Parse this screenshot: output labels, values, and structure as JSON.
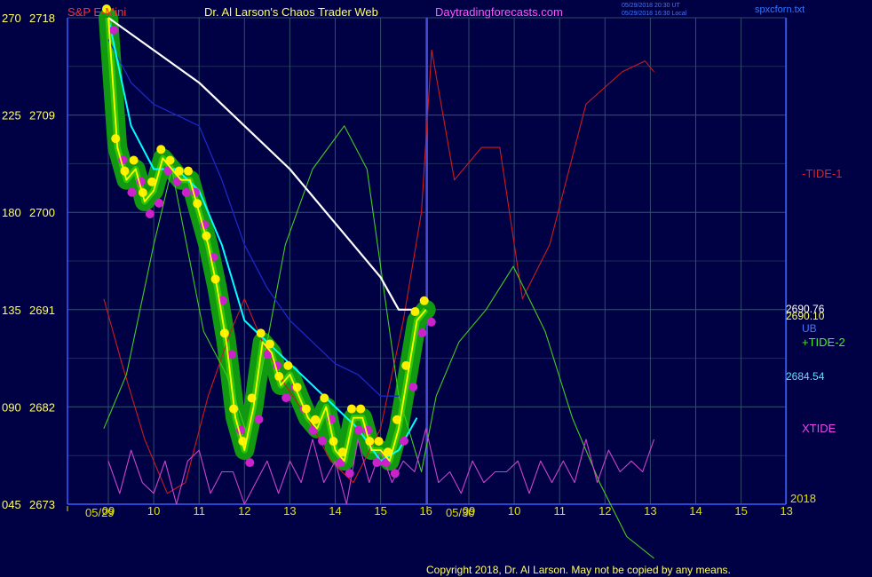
{
  "header": {
    "instrument": "S&P E-Mini",
    "title": "Dr. Al Larson's Chaos Trader Web",
    "site": "Daytradingforecasts.com",
    "stamp1": "05/29/2018 20:30 UT",
    "stamp2": "05/29/2018 16:30 Local",
    "filename": "spxcforn.txt"
  },
  "copyright": "Copyright 2018, Dr. Al Larson. May not be copied by any means.",
  "colors": {
    "background": "#000044",
    "grid": "#2e4d6a",
    "axis": "#3a5cff",
    "now_line": "#5a5aff",
    "label_left": "#ffff66",
    "label_right": "#ffffff"
  },
  "chart_data": {
    "type": "line",
    "title": "S&P E-Mini",
    "xlabel": "",
    "ylabel": "",
    "left_scale_labels": [
      "270",
      "225",
      "180",
      "135",
      "090",
      "045"
    ],
    "price_axis_labels": [
      "2718",
      "2709",
      "2700",
      "2691",
      "2682",
      "2673"
    ],
    "ylim": [
      2673,
      2718
    ],
    "x_hour_labels": [
      "09",
      "10",
      "11",
      "12",
      "13",
      "14",
      "15",
      "16",
      "09",
      "10",
      "11",
      "12",
      "13",
      "14",
      "15",
      "13"
    ],
    "x_date_labels": [
      "05/29",
      "05/30"
    ],
    "year_label": "2018",
    "grid": true,
    "right_labels": {
      "tide1": "-TIDE-1",
      "price1": "2690.76",
      "price2": "2690.10",
      "ub": "UB",
      "tide2": "+TIDE-2",
      "price3": "2684.54",
      "xtide": "XTIDE"
    },
    "series": [
      {
        "key": "price",
        "color": "#ffff00",
        "x": [
          9.0,
          9.2,
          9.4,
          9.6,
          9.8,
          10.0,
          10.2,
          10.4,
          10.6,
          10.8,
          11.0,
          11.2,
          11.4,
          11.6,
          11.8,
          12.0,
          12.2,
          12.4,
          12.6,
          12.8,
          13.0,
          13.2,
          13.4,
          13.6,
          13.8,
          14.0,
          14.2,
          14.4,
          14.6,
          14.8,
          15.0,
          15.2,
          15.4,
          15.6,
          15.8,
          16.0
        ],
        "y": [
          2718,
          2706,
          2703,
          2704,
          2701,
          2702,
          2705,
          2704,
          2703,
          2703,
          2700,
          2697,
          2693,
          2688,
          2681,
          2678,
          2682,
          2688,
          2687,
          2684,
          2685,
          2683,
          2681,
          2680,
          2682,
          2678,
          2677,
          2681,
          2681,
          2678,
          2678,
          2677,
          2680,
          2685,
          2690,
          2691
        ]
      },
      {
        "key": "ma1",
        "color": "#ffffff",
        "x": [
          9.0,
          10.0,
          11.0,
          12.0,
          13.0,
          14.0,
          15.0,
          15.4,
          15.8
        ],
        "y": [
          2718,
          2715,
          2712,
          2708,
          2704,
          2699,
          2694,
          2691,
          2691
        ]
      },
      {
        "key": "ma2",
        "color": "#00ffff",
        "x": [
          9.0,
          9.5,
          10.0,
          10.5,
          11.0,
          11.5,
          12.0,
          12.5,
          13.0,
          13.5,
          14.0,
          14.5,
          15.0,
          15.4,
          15.8
        ],
        "y": [
          2718,
          2708,
          2704,
          2704,
          2702,
          2697,
          2690,
          2688,
          2686,
          2684,
          2682,
          2680,
          2677,
          2678,
          2681
        ]
      },
      {
        "key": "ma3",
        "color": "#1a28c8",
        "x": [
          9.0,
          9.5,
          10.0,
          10.5,
          11.0,
          11.5,
          12.0,
          12.5,
          13.0,
          13.5,
          14.0,
          14.5,
          15.0,
          15.4
        ],
        "y": [
          2716,
          2712,
          2710,
          2709,
          2708,
          2703,
          2697,
          2693,
          2690,
          2688,
          2686,
          2685,
          2683,
          2683
        ]
      },
      {
        "key": "tide1",
        "color": "#cc1c1c",
        "x": [
          8.9,
          9.3,
          9.8,
          10.3,
          10.7,
          11.2,
          11.7,
          12.0,
          12.4,
          12.9,
          13.4,
          13.9,
          14.4,
          15.0,
          15.5,
          15.9,
          16.1,
          16.6,
          17.2,
          17.6,
          18.1,
          18.7,
          19.5,
          20.3,
          20.8,
          21.0
        ],
        "y": [
          692,
          686,
          679,
          674,
          675,
          683,
          689,
          692,
          688,
          684,
          681,
          677,
          675,
          680,
          690,
          700,
          715,
          703,
          706,
          706,
          692,
          697,
          710,
          713,
          714,
          713
        ]
      },
      {
        "key": "tide2",
        "color": "#44cc22",
        "x": [
          8.9,
          9.4,
          10.0,
          10.4,
          11.1,
          11.6,
          12.1,
          12.9,
          13.5,
          14.2,
          14.7,
          15.4,
          15.9,
          16.2,
          16.7,
          17.3,
          17.9,
          18.6,
          19.2,
          19.8,
          20.4,
          21.0
        ],
        "y": [
          680,
          685,
          697,
          704,
          689,
          685,
          679,
          697,
          704,
          708,
          704,
          683,
          676,
          683,
          688,
          691,
          695,
          689,
          681,
          675,
          670,
          668
        ]
      },
      {
        "key": "xtide",
        "color": "#cc44cc",
        "x": [
          9.0,
          9.25,
          9.5,
          9.75,
          10.0,
          10.25,
          10.5,
          10.75,
          11.0,
          11.25,
          11.5,
          11.75,
          12.0,
          12.25,
          12.5,
          12.75,
          13.0,
          13.25,
          13.5,
          13.75,
          14.0,
          14.25,
          14.5,
          14.75,
          15.0,
          15.25,
          15.5,
          15.75,
          16.0,
          16.25,
          16.5,
          16.75,
          17.0,
          17.25,
          17.5,
          17.75,
          18.0,
          18.25,
          18.5,
          18.75,
          19.0,
          19.25,
          19.5,
          19.75,
          20.0,
          20.25,
          20.5,
          20.75,
          21.0
        ],
        "y": [
          677,
          674,
          678,
          675,
          674,
          677,
          673,
          677,
          678,
          674,
          676,
          676,
          673,
          675,
          677,
          674,
          677,
          675,
          679,
          675,
          677,
          673,
          679,
          675,
          678,
          675,
          677,
          676,
          680,
          675,
          676,
          674,
          677,
          675,
          676,
          676,
          677,
          674,
          677,
          675,
          677,
          675,
          679,
          675,
          678,
          676,
          677,
          676,
          679
        ]
      }
    ]
  }
}
